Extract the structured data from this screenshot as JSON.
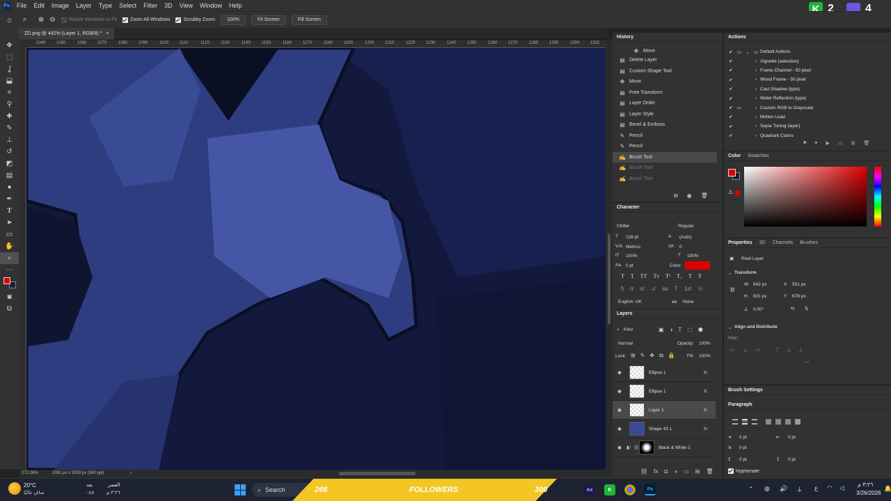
{
  "menubar": {
    "items": [
      "File",
      "Edit",
      "Image",
      "Layer",
      "Type",
      "Select",
      "Filter",
      "3D",
      "View",
      "Window",
      "Help"
    ],
    "app_icon": "Ps"
  },
  "options": {
    "resize_windows": "Resize Windows to Fit",
    "zoom_all": "Zoom All Windows",
    "scrubby": "Scrubby Zoom",
    "zoom_pct": "100%",
    "fit_screen": "Fit Screen",
    "fill_screen": "Fill Screen"
  },
  "overlay": {
    "k_label": "K",
    "k_value": "2",
    "u_value": "4"
  },
  "document": {
    "tab_title": "ZD.png @ 442% (Layer 1, RGB/8) *",
    "ruler_ticks": [
      "1040",
      "1050",
      "1060",
      "1070",
      "1080",
      "1090",
      "1100",
      "1110",
      "1120",
      "1130",
      "1140",
      "1150",
      "1160",
      "1170",
      "1180",
      "1190",
      "1200",
      "1210",
      "1220",
      "1230",
      "1240",
      "1250",
      "1260",
      "1270",
      "1280",
      "1290",
      "1300",
      "1310"
    ],
    "zoom": "272.26%",
    "doc_size": "2091 px x 2059 px (300 ppi)"
  },
  "history": {
    "title": "History",
    "items": [
      "Move",
      "Delete Layer",
      "Custom Shape Tool",
      "Move",
      "Free Transform",
      "Layer Order",
      "Layer Style",
      "Bevel & Emboss",
      "Pencil",
      "Pencil",
      "Brush Tool",
      "Brush Tool",
      "Brush Tool"
    ],
    "icons": [
      "move-icon",
      "layer-icon",
      "layer-icon",
      "move-icon",
      "layer-icon",
      "layer-icon",
      "layer-icon",
      "layer-icon",
      "pencil-icon",
      "pencil-icon",
      "brush-icon",
      "brush-icon",
      "brush-icon"
    ]
  },
  "actions": {
    "title": "Actions",
    "items": [
      "Default Actions",
      "Vignette (selection)",
      "Frame Channel - 50 pixel",
      "Wood Frame - 50 pixel",
      "Cast Shadow (type)",
      "Water Reflection (type)",
      "Custom RGB to Grayscale",
      "Molten Lead",
      "Sepia Toning (layer)",
      "Quadrant Colors"
    ]
  },
  "color": {
    "tabs": [
      "Color",
      "Swatches"
    ],
    "foreground": "#e00000",
    "background": "#1b1f3b"
  },
  "character": {
    "title": "Character",
    "font": "Chiller",
    "style": "Regular",
    "size": "128 pt",
    "leading": "(Auto)",
    "kerning": "Metrics",
    "tracking": "0",
    "vscale": "100%",
    "hscale": "100%",
    "baseline": "0 pt",
    "color_label": "Color:",
    "color": "#e00000",
    "language": "English: UK",
    "aa": "None"
  },
  "properties": {
    "tabs": [
      "Properties",
      "3D",
      "Channels",
      "Brushes"
    ],
    "layer_type": "Pixel Layer",
    "transform_label": "Transform",
    "w": "942 px",
    "h": "831 px",
    "x": "551 px",
    "y": "678 px",
    "angle": "0.00°",
    "align_label": "Align and Distribute",
    "align_sub": "Align:"
  },
  "layers": {
    "title": "Layers",
    "kind": "Kind",
    "blend": "Normal",
    "opacity_label": "Opacity:",
    "opacity": "100%",
    "lock_label": "Lock:",
    "fill_label": "Fill:",
    "fill": "100%",
    "items": [
      "Ellipse 1",
      "Ellipse 1",
      "Layer 1",
      "Shape 43 1",
      "Black & White 1"
    ]
  },
  "brush_settings": {
    "title": "Brush Settings"
  },
  "paragraph": {
    "title": "Paragraph",
    "indent_left": "0 pt",
    "indent_right": "0 pt",
    "first_line": "0 pt",
    "space_before": "0 pt",
    "space_after": "0 pt",
    "hyphenate": "Hyphenate"
  },
  "taskbar": {
    "temp": "20°C",
    "weather": "صافٍ غالبًا",
    "prayer1": "بعد",
    "prayer1_time": "٠:٤٨",
    "prayer2": "العصر",
    "prayer2_time": "٣:٢٦ م",
    "search": "Search",
    "banner_left": "266",
    "banner_mid": "FOLLOWERS",
    "banner_right": "300",
    "lang": "ع",
    "time": "٣:٢٦ م",
    "date": "3/26/2026"
  }
}
